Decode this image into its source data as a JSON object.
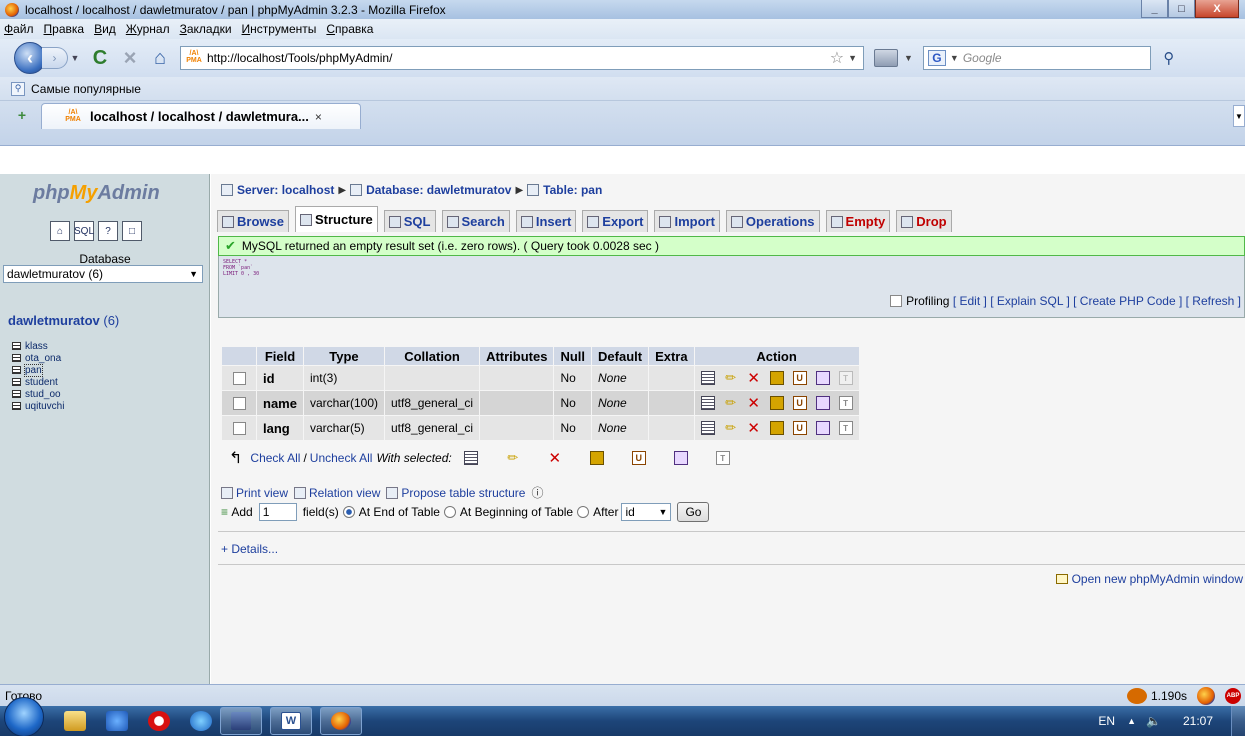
{
  "window": {
    "title": "localhost / localhost / dawletmuratov / pan | phpMyAdmin 3.2.3 - Mozilla Firefox"
  },
  "menu": [
    "Файл",
    "Правка",
    "Вид",
    "Журнал",
    "Закладки",
    "Инструменты",
    "Справка"
  ],
  "nav": {
    "url": "http://localhost/Tools/phpMyAdmin/",
    "search_placeholder": "Google"
  },
  "bookmarks": {
    "popular": "Самые популярные"
  },
  "tab": {
    "label": "localhost / localhost / dawletmura...",
    "close": "×"
  },
  "sidebar": {
    "logo_php": "php",
    "logo_my": "My",
    "logo_admin": "Admin",
    "database_label": "Database",
    "database_selected": "dawletmuratov (6)",
    "db_name": "dawletmuratov",
    "db_count": "(6)",
    "tables": [
      "klass",
      "ota_ona",
      "pan",
      "student",
      "stud_oo",
      "uqituvchi"
    ]
  },
  "breadcrumb": {
    "server": "Server: localhost",
    "database": "Database: dawletmuratov",
    "table": "Table: pan"
  },
  "tabs": [
    "Browse",
    "Structure",
    "SQL",
    "Search",
    "Insert",
    "Export",
    "Import",
    "Operations",
    "Empty",
    "Drop"
  ],
  "notice": "MySQL returned an empty result set (i.e. zero rows). ( Query took 0.0028 sec )",
  "sql": {
    "lines": [
      "SELECT *",
      "FROM `pan`",
      "LIMIT 0 , 30"
    ],
    "profiling": "Profiling",
    "links": [
      "[ Edit ]",
      "[ Explain SQL ]",
      "[ Create PHP Code ]",
      "[ Refresh ]"
    ]
  },
  "structure": {
    "headers": [
      "Field",
      "Type",
      "Collation",
      "Attributes",
      "Null",
      "Default",
      "Extra",
      "Action"
    ],
    "rows": [
      {
        "field": "id",
        "type": "int(3)",
        "collation": "",
        "attributes": "",
        "null": "No",
        "default": "None",
        "extra": ""
      },
      {
        "field": "name",
        "type": "varchar(100)",
        "collation": "utf8_general_ci",
        "attributes": "",
        "null": "No",
        "default": "None",
        "extra": ""
      },
      {
        "field": "lang",
        "type": "varchar(5)",
        "collation": "utf8_general_ci",
        "attributes": "",
        "null": "No",
        "default": "None",
        "extra": ""
      }
    ],
    "check_all": "Check All",
    "uncheck_all": "Uncheck All",
    "slash": "/",
    "with_selected": "With selected:"
  },
  "links": {
    "print_view": "Print view",
    "relation_view": "Relation view",
    "propose": "Propose table structure"
  },
  "add_field": {
    "add": "Add",
    "count": "1",
    "fields_label": "field(s)",
    "at_end": "At End of Table",
    "at_beginning": "At Beginning of Table",
    "after": "After",
    "after_field": "id",
    "go": "Go"
  },
  "details": "+ Details...",
  "open_new": "Open new phpMyAdmin window",
  "status": {
    "text": "Готово",
    "timing": "1.190s"
  },
  "taskbar": {
    "lang": "EN",
    "time": "21:07"
  }
}
